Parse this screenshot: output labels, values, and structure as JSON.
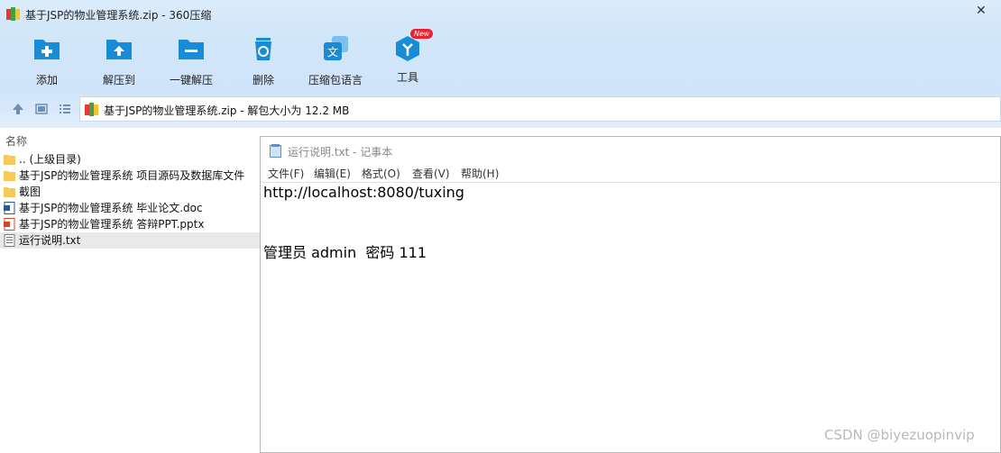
{
  "window": {
    "title": "基于JSP的物业管理系统.zip - 360压缩",
    "close_glyph": "✕"
  },
  "toolbar": {
    "items": [
      {
        "label": "添加",
        "icon": "add-folder-icon"
      },
      {
        "label": "解压到",
        "icon": "extract-to-icon"
      },
      {
        "label": "一键解压",
        "icon": "one-click-extract-icon"
      },
      {
        "label": "删除",
        "icon": "recycle-bin-icon"
      },
      {
        "label": "压缩包语言",
        "icon": "language-icon"
      },
      {
        "label": "工具",
        "icon": "tools-icon",
        "badge": "New"
      }
    ]
  },
  "address": {
    "text": "基于JSP的物业管理系统.zip - 解包大小为 12.2 MB"
  },
  "filelist": {
    "header": "名称",
    "rows": [
      {
        "name": ".. (上级目录)",
        "type": "folder"
      },
      {
        "name": "基于JSP的物业管理系统 项目源码及数据库文件",
        "type": "folder"
      },
      {
        "name": "截图",
        "type": "folder"
      },
      {
        "name": "基于JSP的物业管理系统 毕业论文.doc",
        "type": "doc"
      },
      {
        "name": "基于JSP的物业管理系统 答辩PPT.pptx",
        "type": "ppt"
      },
      {
        "name": "运行说明.txt",
        "type": "txt",
        "selected": true
      }
    ]
  },
  "notepad": {
    "title": "运行说明.txt - 记事本",
    "menu": [
      "文件(F)",
      "编辑(E)",
      "格式(O)",
      "查看(V)",
      "帮助(H)"
    ],
    "lines": [
      "http://localhost:8080/tuxing",
      "管理员 admin  密码 111"
    ]
  },
  "watermark": "CSDN @biyezuopinvip",
  "colors": {
    "accent": "#1a8bd6",
    "toolbar_bg": "#d3e7fa",
    "badge": "#e8222e"
  }
}
